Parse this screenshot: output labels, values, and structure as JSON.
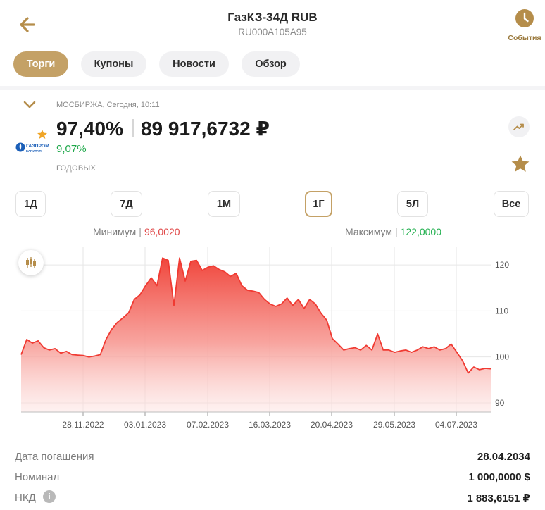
{
  "header": {
    "title": "ГазКЗ-34Д RUB",
    "isin": "RU000A105A95",
    "events_label": "События",
    "back_icon": "arrow-left-icon",
    "events_icon": "clock-icon"
  },
  "tabs": [
    {
      "label": "Торги",
      "active": true
    },
    {
      "label": "Купоны",
      "active": false
    },
    {
      "label": "Новости",
      "active": false
    },
    {
      "label": "Обзор",
      "active": false
    }
  ],
  "quote": {
    "exchange_line": "МОСБИРЖА, Сегодня, 10:11",
    "price_percent": "97,40%",
    "price_value": "89 917,6732 ₽",
    "yield": "9,07%",
    "yield_label": "ГОДОВЫХ",
    "logo_text": "ГАЗПРОМ",
    "logo_subtext": "КАПИТАЛ"
  },
  "periods": [
    {
      "label": "1Д",
      "active": false
    },
    {
      "label": "7Д",
      "active": false
    },
    {
      "label": "1М",
      "active": false
    },
    {
      "label": "1Г",
      "active": true
    },
    {
      "label": "5Л",
      "active": false
    },
    {
      "label": "Все",
      "active": false
    }
  ],
  "range": {
    "min_label": "Минимум",
    "min_value": "96,0020",
    "max_label": "Максимум",
    "max_value": "122,0000"
  },
  "colors": {
    "accent": "#c4a166",
    "chart_line": "#f03a32",
    "positive": "#22b04f",
    "negative": "#e04848"
  },
  "chart_data": {
    "type": "area",
    "x_ticks": [
      "28.11.2022",
      "03.01.2023",
      "07.02.2023",
      "16.03.2023",
      "20.04.2023",
      "29.05.2023",
      "04.07.2023"
    ],
    "y_ticks": [
      90,
      100,
      110,
      120
    ],
    "ylim": [
      88,
      124
    ],
    "grid": true,
    "series": [
      {
        "values": [
          100.5,
          103.8,
          103.0,
          103.5,
          102.0,
          101.5,
          101.8,
          100.8,
          101.2,
          100.5,
          100.4,
          100.3,
          100.0,
          100.2,
          100.5,
          103.8,
          106.0,
          107.5,
          108.5,
          109.6,
          112.5,
          113.5,
          115.5,
          117.2,
          115.5,
          121.5,
          121.0,
          111.2,
          121.5,
          116.5,
          120.8,
          121.0,
          118.8,
          119.5,
          119.8,
          119.0,
          118.5,
          117.5,
          118.2,
          115.5,
          114.5,
          114.3,
          114.0,
          112.5,
          111.5,
          111.0,
          111.5,
          112.8,
          111.2,
          112.5,
          110.5,
          112.5,
          111.5,
          109.5,
          108.0,
          104.0,
          102.8,
          101.5,
          101.8,
          102.0,
          101.5,
          102.5,
          101.5,
          105.0,
          101.5,
          101.5,
          101.0,
          101.3,
          101.5,
          101.0,
          101.5,
          102.2,
          101.8,
          102.2,
          101.5,
          101.8,
          102.8,
          101.0,
          99.2,
          96.5,
          97.8,
          97.2,
          97.5,
          97.4
        ]
      }
    ]
  },
  "info": [
    {
      "label": "Дата погашения",
      "value": "28.04.2034",
      "has_info": false
    },
    {
      "label": "Номинал",
      "value": "1 000,0000 $",
      "has_info": false
    },
    {
      "label": "НКД",
      "value": "1 883,6151 ₽",
      "has_info": true
    }
  ]
}
